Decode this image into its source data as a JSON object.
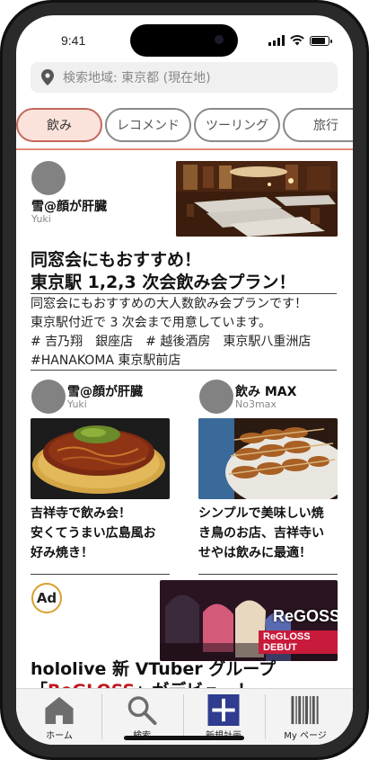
{
  "status": {
    "time": "9:41"
  },
  "search": {
    "placeholder": "検索地域: 東京都 (現在地)"
  },
  "tabs": [
    {
      "label": "飲み",
      "active": true
    },
    {
      "label": "レコメンド",
      "active": false
    },
    {
      "label": "ツーリング",
      "active": false
    },
    {
      "label": "旅行",
      "active": false
    }
  ],
  "feature_post": {
    "author_name": "雪@顔が肝臓",
    "author_id": "Yuki",
    "title_line1": "同窓会にもおすすめ！",
    "title_line2": "東京駅 1,2,3 次会飲み会プラン！",
    "body_line1": "同窓会にもおすすめの大人数飲み会プランです！",
    "body_line2": "東京駅付近で 3 次会まで用意しています。",
    "body_line3": "# 吉乃翔　銀座店　# 越後酒房　東京駅八重洲店",
    "body_line4": "#HANAKOMA 東京駅前店"
  },
  "posts": [
    {
      "author_name": "雪@顔が肝臓",
      "author_id": "Yuki",
      "title_line1": "吉祥寺で飲み会！",
      "title_line2": "安くてうまい広島風お",
      "title_line3": "好み焼き！"
    },
    {
      "author_name": "飲み MAX",
      "author_id": "No3max",
      "title_line1": "シンプルで美味しい焼",
      "title_line2": "き鳥のお店、吉祥寺い",
      "title_line3": "せやは飲みに最適！"
    }
  ],
  "ad": {
    "badge": "Ad",
    "banner_logo": "ReGOSS",
    "banner_sub": "ReGLOSS DEBUT",
    "title_line1": "hololive 新 VTuber グループ",
    "title_open": "「",
    "title_accent": "ReGLOSS",
    "title_close": "」がデビュー！"
  },
  "bottom_nav": [
    {
      "label": "ホーム",
      "icon": "home-icon"
    },
    {
      "label": "検索",
      "icon": "search-icon"
    },
    {
      "label": "新規計画",
      "icon": "plus-icon"
    },
    {
      "label": "My ページ",
      "icon": "barcode-icon"
    }
  ],
  "colors": {
    "accent": "#e58a75",
    "tab_active_bg": "#fbe3dc",
    "ad_accent": "#c0161e",
    "plus_bg": "#2f3c8f"
  }
}
